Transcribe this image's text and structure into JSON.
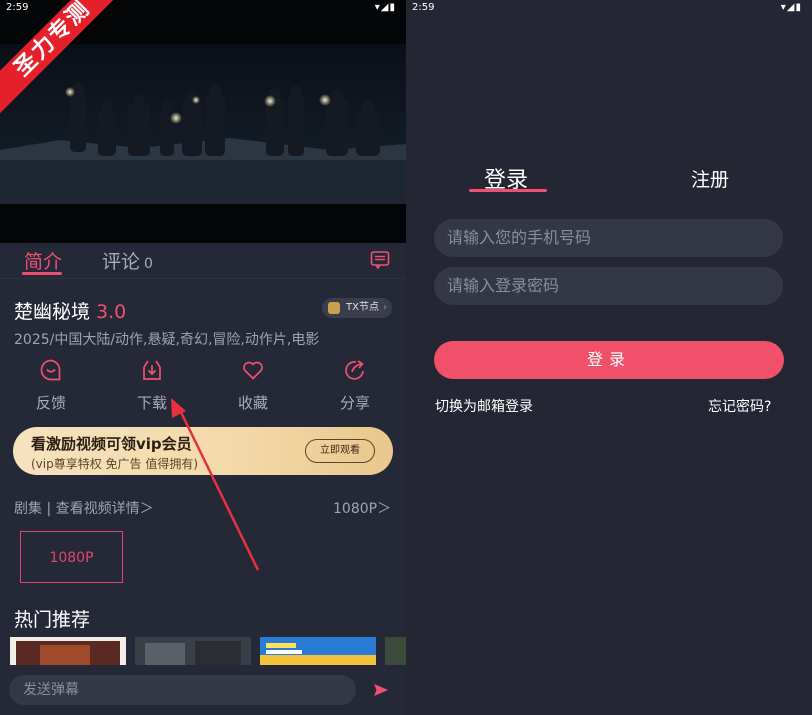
{
  "status_bar": {
    "time": "2:59",
    "icons": "▾◢▮"
  },
  "watermark": {
    "text": "圣力专测"
  },
  "left": {
    "tabs": [
      {
        "label": "简介"
      },
      {
        "label": "评论",
        "count": "0"
      }
    ],
    "title": "楚幽秘境",
    "score": "3.0",
    "node_button": {
      "label": "TX节点",
      "chevron": "›"
    },
    "meta": "2025/中国大陆/动作,悬疑,奇幻,冒险,动作片,电影",
    "actions": [
      {
        "label": "反馈",
        "icon": "feedback-icon"
      },
      {
        "label": "下载",
        "icon": "download-icon"
      },
      {
        "label": "收藏",
        "icon": "heart-icon"
      },
      {
        "label": "分享",
        "icon": "share-icon"
      }
    ],
    "banner": {
      "title": "看激励视频可领vip会员",
      "subtitle": "(vip尊享特权 免广告 值得拥有)",
      "button": "立即观看"
    },
    "episodes_link": "剧集 | 查看视频详情＞",
    "quality_link": "1080P＞",
    "episode": "1080P",
    "hot_title": "热门推荐",
    "comment_placeholder": "发送弹幕",
    "accent": "#f05070"
  },
  "right": {
    "tabs": {
      "login": "登录",
      "register": "注册"
    },
    "phone_placeholder": "请输入您的手机号码",
    "password_placeholder": "请输入登录密码",
    "login_button": "登录",
    "email_login": "切换为邮箱登录",
    "forgot_password": "忘记密码?",
    "accent": "#f0506a"
  }
}
